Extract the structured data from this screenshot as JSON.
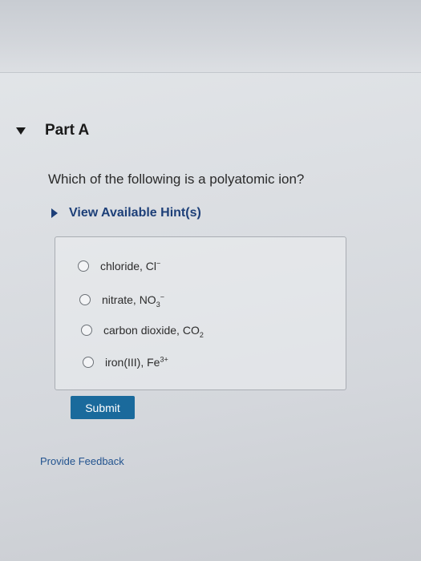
{
  "part": {
    "title": "Part A"
  },
  "question": {
    "text": "Which of the following is a polyatomic ion?"
  },
  "hints": {
    "label": "View Available Hint(s)"
  },
  "options": [
    {
      "label": "chloride, Cl",
      "sup": "−"
    },
    {
      "label": "nitrate, NO",
      "sub": "3",
      "sup": "−"
    },
    {
      "label": "carbon dioxide, CO",
      "sub": "2"
    },
    {
      "label": "iron(III), Fe",
      "sup": "3+"
    }
  ],
  "submit": {
    "label": "Submit"
  },
  "feedback": {
    "label": "Provide Feedback"
  },
  "colors": {
    "link": "#1d3f78",
    "submit_bg": "#1a6a9c"
  },
  "icons": {
    "part_toggle": "triangle-down-icon",
    "hint_toggle": "triangle-right-icon"
  }
}
